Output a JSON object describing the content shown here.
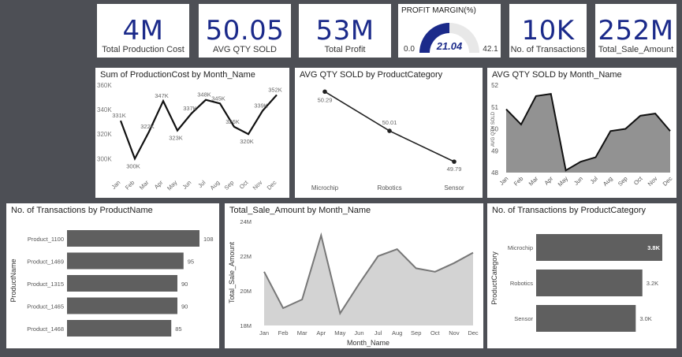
{
  "kpis": [
    {
      "value": "4M",
      "label": "Total Production Cost"
    },
    {
      "value": "50.05",
      "label": "AVG QTY SOLD"
    },
    {
      "value": "53M",
      "label": "Total Profit"
    },
    {
      "value": "10K",
      "label": "No. of Transactions"
    },
    {
      "value": "252M",
      "label": "Total_Sale_Amount"
    }
  ],
  "gauge": {
    "title": "PROFIT MARGIN(%)",
    "value": "21.04",
    "min": "0.0",
    "max": "42.1",
    "fraction": 0.5,
    "color": "#1b2a8a"
  },
  "chart_data": [
    {
      "type": "line",
      "title": "Sum of ProductionCost by Month_Name",
      "x": [
        "Jan",
        "Feb",
        "Mar",
        "Apr",
        "May",
        "Jun",
        "Jul",
        "Aug",
        "Sep",
        "Oct",
        "Nov",
        "Dec"
      ],
      "values": [
        331,
        300,
        322,
        347,
        323,
        337,
        348,
        345,
        326,
        320,
        339,
        352
      ],
      "data_labels": [
        "331K",
        "300K",
        "322K",
        "347K",
        "323K",
        "337K",
        "348K",
        "345K",
        "326K",
        "320K",
        "339K",
        "352K"
      ],
      "yticks": [
        "300K",
        "320K",
        "340K",
        "360K"
      ],
      "ylim": [
        297,
        360
      ]
    },
    {
      "type": "line",
      "title": "AVG QTY SOLD by ProductCategory",
      "x": [
        "Microchip",
        "Robotics",
        "Sensor"
      ],
      "values": [
        50.29,
        50.01,
        49.79
      ],
      "data_labels": [
        "50.29",
        "50.01",
        "49.79"
      ],
      "ylim": [
        49.74,
        50.32
      ]
    },
    {
      "type": "area",
      "title": "AVG QTY SOLD by Month_Name",
      "x": [
        "Jan",
        "Feb",
        "Mar",
        "Apr",
        "May",
        "Jun",
        "Jul",
        "Aug",
        "Sep",
        "Oct",
        "Nov",
        "Dec"
      ],
      "values": [
        50.9,
        50.2,
        51.5,
        51.6,
        48.1,
        48.5,
        48.7,
        49.9,
        50.0,
        50.6,
        50.7,
        49.9
      ],
      "ylabel": "AVG QTY SOLD",
      "yticks": [
        "48",
        "49",
        "50",
        "51",
        "52"
      ],
      "ylim": [
        48,
        52
      ]
    },
    {
      "type": "bar",
      "orientation": "horizontal",
      "title": "No. of Transactions by ProductName",
      "categories": [
        "Product_1100",
        "Product_1469",
        "Product_1315",
        "Product_1465",
        "Product_1468"
      ],
      "values": [
        108,
        95,
        90,
        90,
        85
      ],
      "data_labels": [
        "108",
        "95",
        "90",
        "90",
        "85"
      ],
      "ylabel": "ProductName",
      "xlim": [
        0,
        108
      ]
    },
    {
      "type": "area",
      "title": "Total_Sale_Amount by Month_Name",
      "x": [
        "Jan",
        "Feb",
        "Mar",
        "Apr",
        "May",
        "Jun",
        "Jul",
        "Aug",
        "Sep",
        "Oct",
        "Nov",
        "Dec"
      ],
      "values": [
        21.1,
        19.0,
        19.5,
        23.2,
        18.7,
        20.4,
        22.0,
        22.4,
        21.3,
        21.1,
        21.6,
        22.2
      ],
      "xlabel": "Month_Name",
      "ylabel": "Total_Sale_Amount",
      "yticks": [
        "18M",
        "20M",
        "22M",
        "24M"
      ],
      "ylim": [
        18,
        24
      ]
    },
    {
      "type": "bar",
      "orientation": "horizontal",
      "title": "No. of Transactions by ProductCategory",
      "categories": [
        "Microchip",
        "Robotics",
        "Sensor"
      ],
      "values": [
        3.8,
        3.2,
        3.0
      ],
      "data_labels": [
        "3.8K",
        "3.2K",
        "3.0K"
      ],
      "ylabel": "ProductCategory",
      "xlim": [
        0,
        3.8
      ]
    }
  ],
  "colors": {
    "kpi_value": "#1b2a8a",
    "series_dark": "#5f5f5f",
    "area_fill": "#8c8c8c",
    "area_fill_light": "#d3d3d3",
    "background": "#4d4f55"
  }
}
